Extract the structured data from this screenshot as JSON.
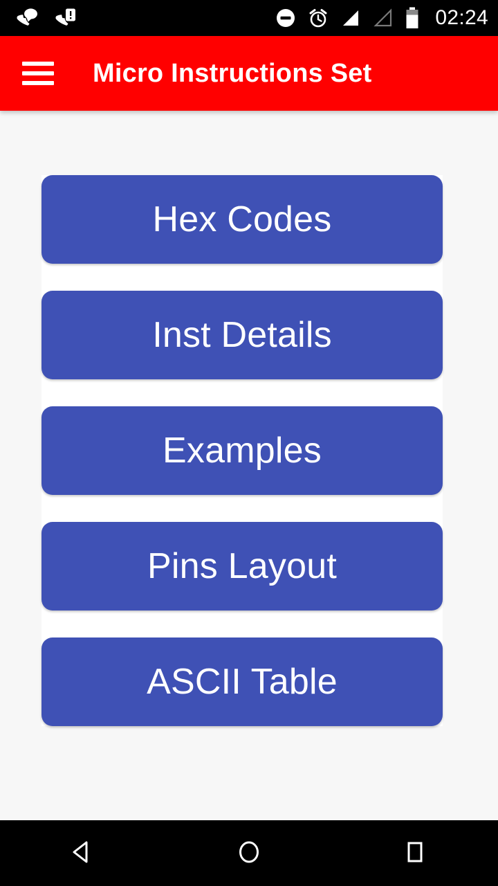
{
  "status_bar": {
    "background": "#000000",
    "left_icons": [
      {
        "name": "missed-call-message-icon",
        "label": "call with message"
      },
      {
        "name": "missed-call-alert-icon",
        "label": "call with alert"
      }
    ],
    "right_icons": [
      {
        "name": "do-not-disturb-icon",
        "label": "Do not disturb"
      },
      {
        "name": "alarm-clock-icon",
        "label": "Alarm set"
      },
      {
        "name": "signal-full-icon",
        "label": "Signal strength full"
      },
      {
        "name": "signal-empty-icon",
        "label": "Second SIM no signal"
      },
      {
        "name": "battery-icon",
        "label": "Battery"
      }
    ],
    "clock": "02:24"
  },
  "app_bar": {
    "title": "Micro Instructions Set",
    "menu_icon": "hamburger-menu-icon",
    "background": "#ff0000",
    "text_color": "#ffffff"
  },
  "main": {
    "background": "#f7f7f7",
    "panel_background": "#ffffff",
    "button_color": "#3f51b5",
    "button_text_color": "#ffffff",
    "buttons": [
      {
        "id": "hex-codes",
        "label": "Hex Codes"
      },
      {
        "id": "inst-details",
        "label": "Inst Details"
      },
      {
        "id": "examples",
        "label": "Examples"
      },
      {
        "id": "pins-layout",
        "label": "Pins Layout"
      },
      {
        "id": "ascii-table",
        "label": "ASCII Table"
      }
    ]
  },
  "nav_bar": {
    "background": "#000000",
    "buttons": [
      {
        "id": "back",
        "name": "nav-back-button",
        "icon": "back-triangle-icon"
      },
      {
        "id": "home",
        "name": "nav-home-button",
        "icon": "home-circle-icon"
      },
      {
        "id": "recents",
        "name": "nav-recents-button",
        "icon": "recents-square-icon"
      }
    ]
  }
}
